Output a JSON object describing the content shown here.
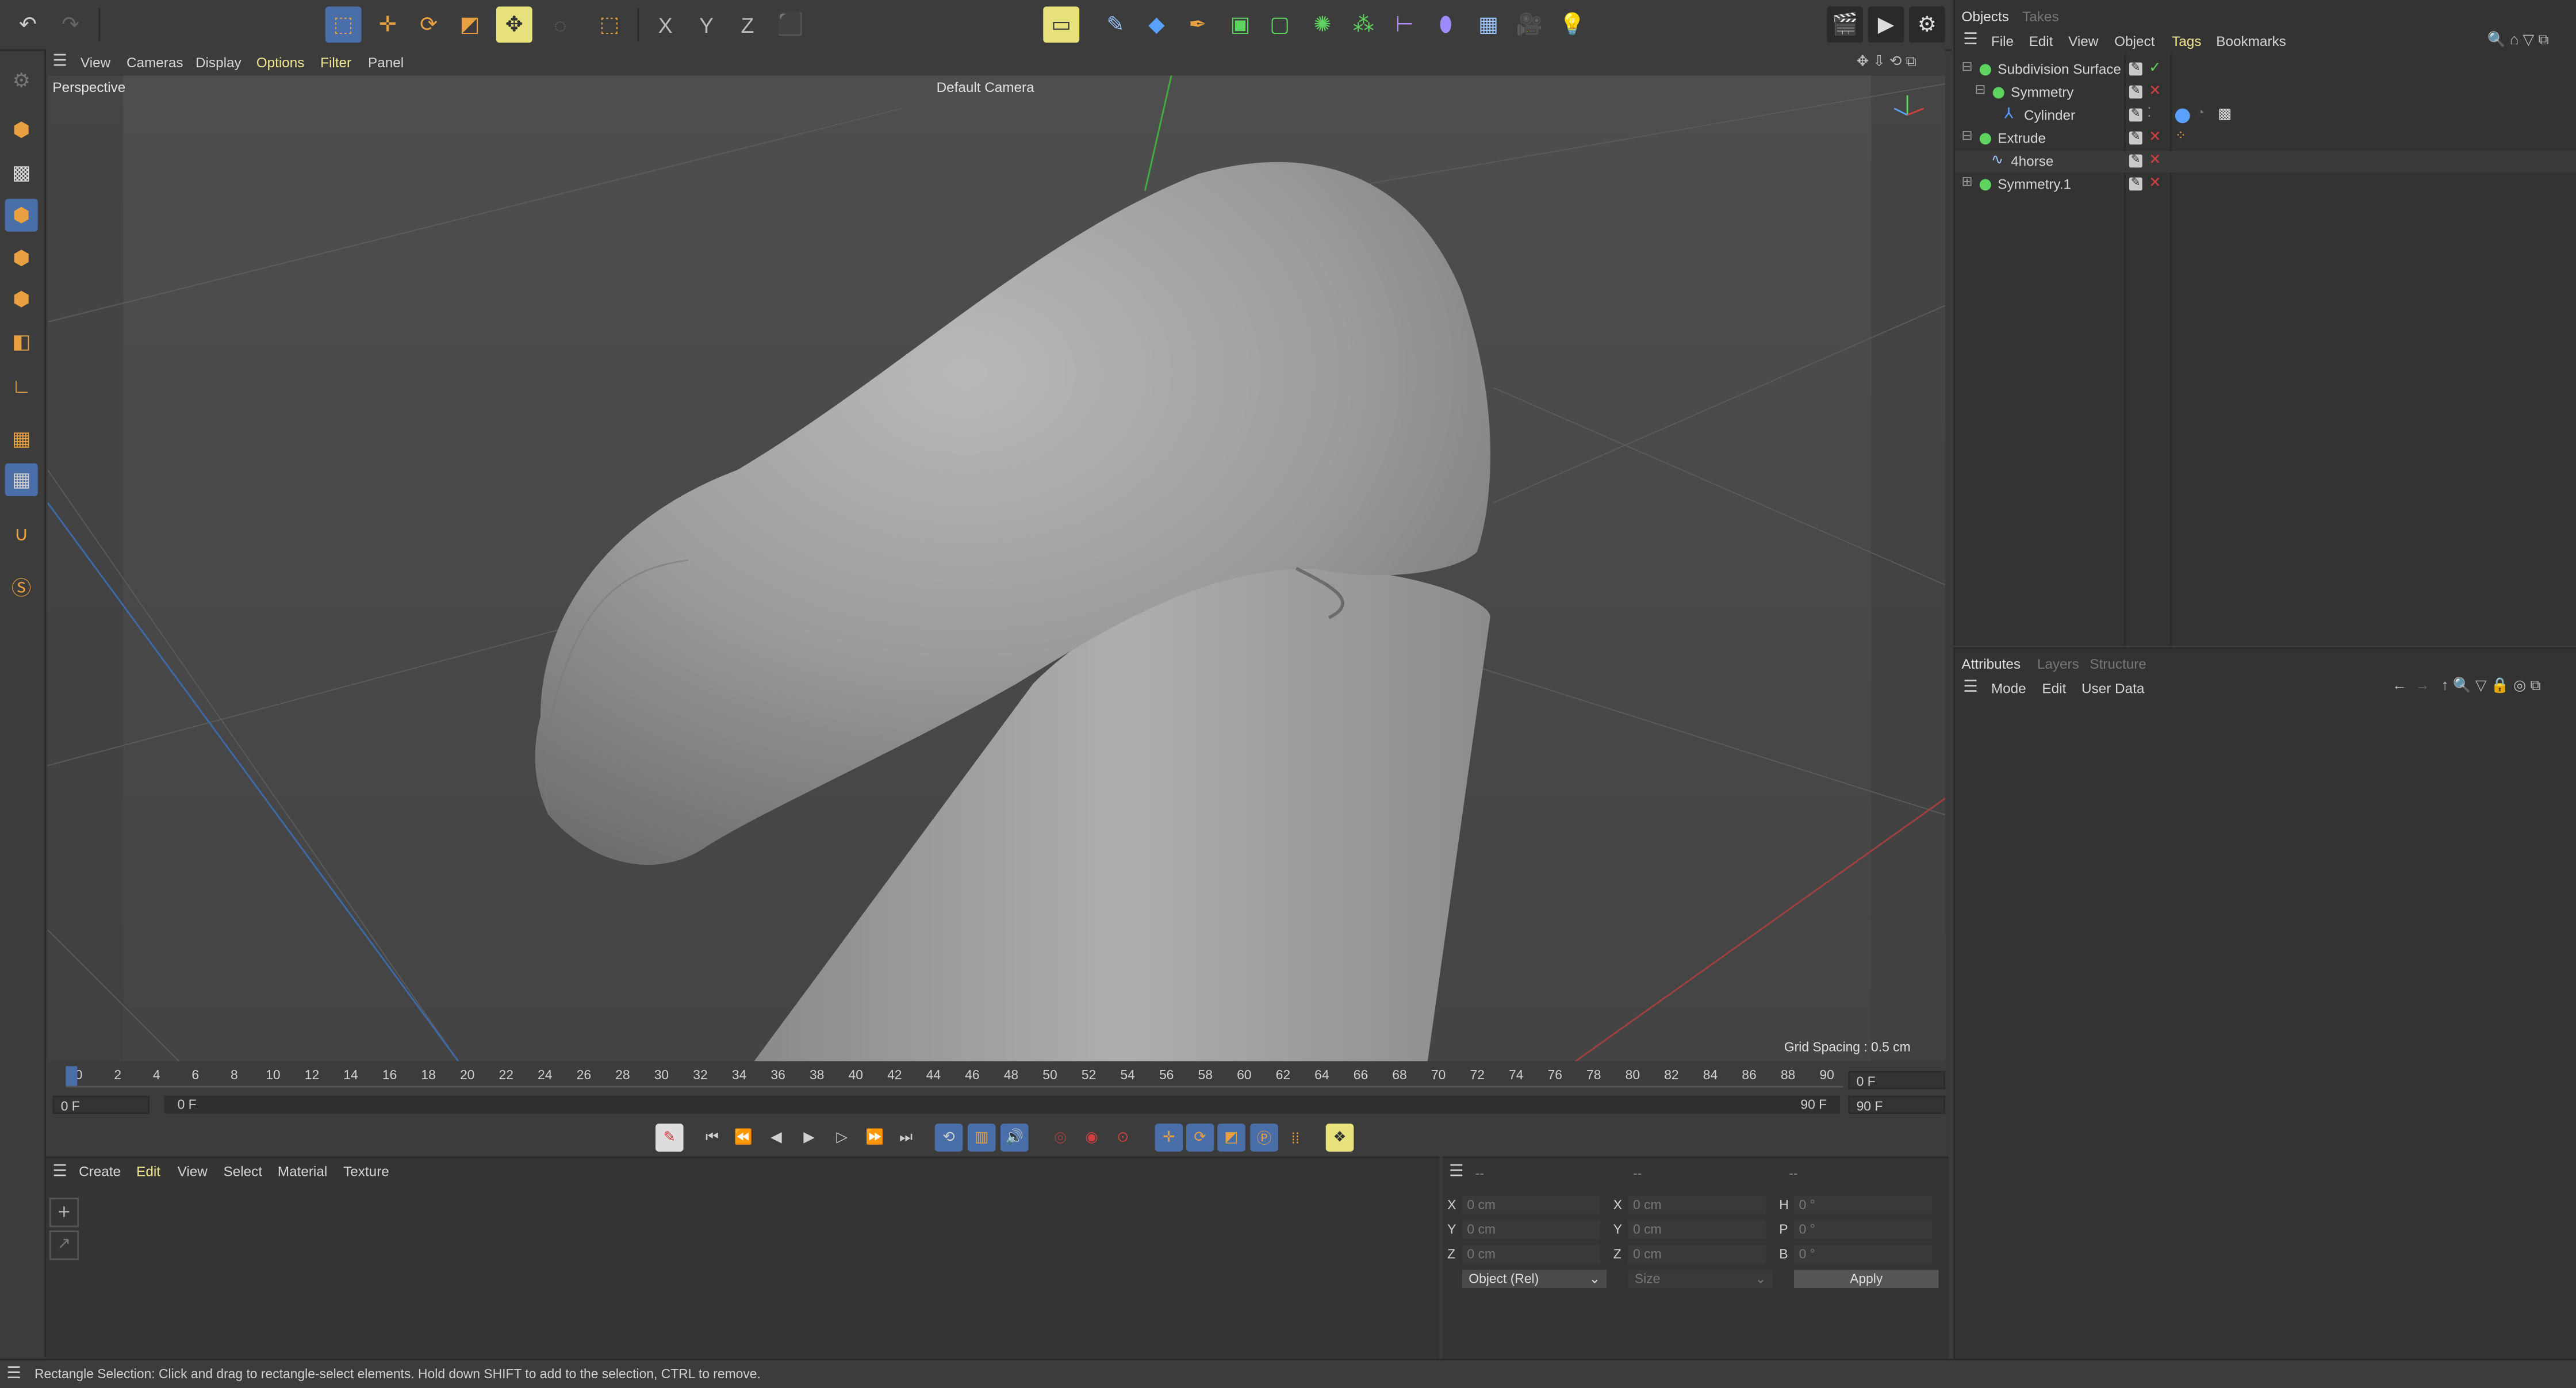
{
  "top_toolbar": {
    "undo_icon": "undo-arrow",
    "redo_icon": "redo-arrow",
    "axis_x": "X",
    "axis_y": "Y",
    "axis_z": "Z"
  },
  "viewport": {
    "menu": [
      "View",
      "Cameras",
      "Display",
      "Options",
      "Filter",
      "Panel"
    ],
    "label": "Perspective",
    "camera": "Default Camera",
    "grid_spacing": "Grid Spacing : 0.5 cm"
  },
  "timeline": {
    "ticks": [
      "0",
      "2",
      "4",
      "6",
      "8",
      "10",
      "12",
      "14",
      "16",
      "18",
      "20",
      "22",
      "24",
      "26",
      "28",
      "30",
      "32",
      "34",
      "36",
      "38",
      "40",
      "42",
      "44",
      "46",
      "48",
      "50",
      "52",
      "54",
      "56",
      "58",
      "60",
      "62",
      "64",
      "66",
      "68",
      "70",
      "72",
      "74",
      "76",
      "78",
      "80",
      "82",
      "84",
      "86",
      "88",
      "90"
    ],
    "current_frame": "0 F",
    "start_field": "0 F",
    "range_start": "0 F",
    "range_end": "90 F",
    "end_field": "90 F",
    "max_field": "90 F"
  },
  "material_manager": {
    "menu": [
      "Create",
      "Edit",
      "View",
      "Select",
      "Material",
      "Texture"
    ]
  },
  "coordinates": {
    "headers": [
      "--",
      "--",
      "--"
    ],
    "rows": [
      {
        "l1": "X",
        "v1": "0 cm",
        "l2": "X",
        "v2": "0 cm",
        "l3": "H",
        "v3": "0 °"
      },
      {
        "l1": "Y",
        "v1": "0 cm",
        "l2": "Y",
        "v2": "0 cm",
        "l3": "P",
        "v3": "0 °"
      },
      {
        "l1": "Z",
        "v1": "0 cm",
        "l2": "Z",
        "v2": "0 cm",
        "l3": "B",
        "v3": "0 °"
      }
    ],
    "mode_select": "Object (Rel)",
    "size_select": "Size",
    "apply_label": "Apply"
  },
  "status_text": "Rectangle Selection: Click and drag to rectangle-select elements. Hold down SHIFT to add to the selection, CTRL to remove.",
  "objects_panel": {
    "tabs": [
      "Objects",
      "Takes"
    ],
    "menu": [
      "File",
      "Edit",
      "View",
      "Object",
      "Tags",
      "Bookmarks"
    ],
    "items": [
      {
        "name": "Subdivision Surface"
      },
      {
        "name": "Symmetry"
      },
      {
        "name": "Cylinder"
      },
      {
        "name": "Extrude"
      },
      {
        "name": "4horse"
      },
      {
        "name": "Symmetry.1"
      }
    ]
  },
  "attributes_panel": {
    "tabs": [
      "Attributes",
      "Layers",
      "Structure"
    ],
    "menu": [
      "Mode",
      "Edit",
      "User Data"
    ]
  },
  "colors": {
    "accent_blue": "#4a6fa8",
    "highlight_yellow": "#e6e17a",
    "menu_yellow": "#f0e68c",
    "tag_red": "#d04040",
    "tag_green": "#5fd35f"
  }
}
